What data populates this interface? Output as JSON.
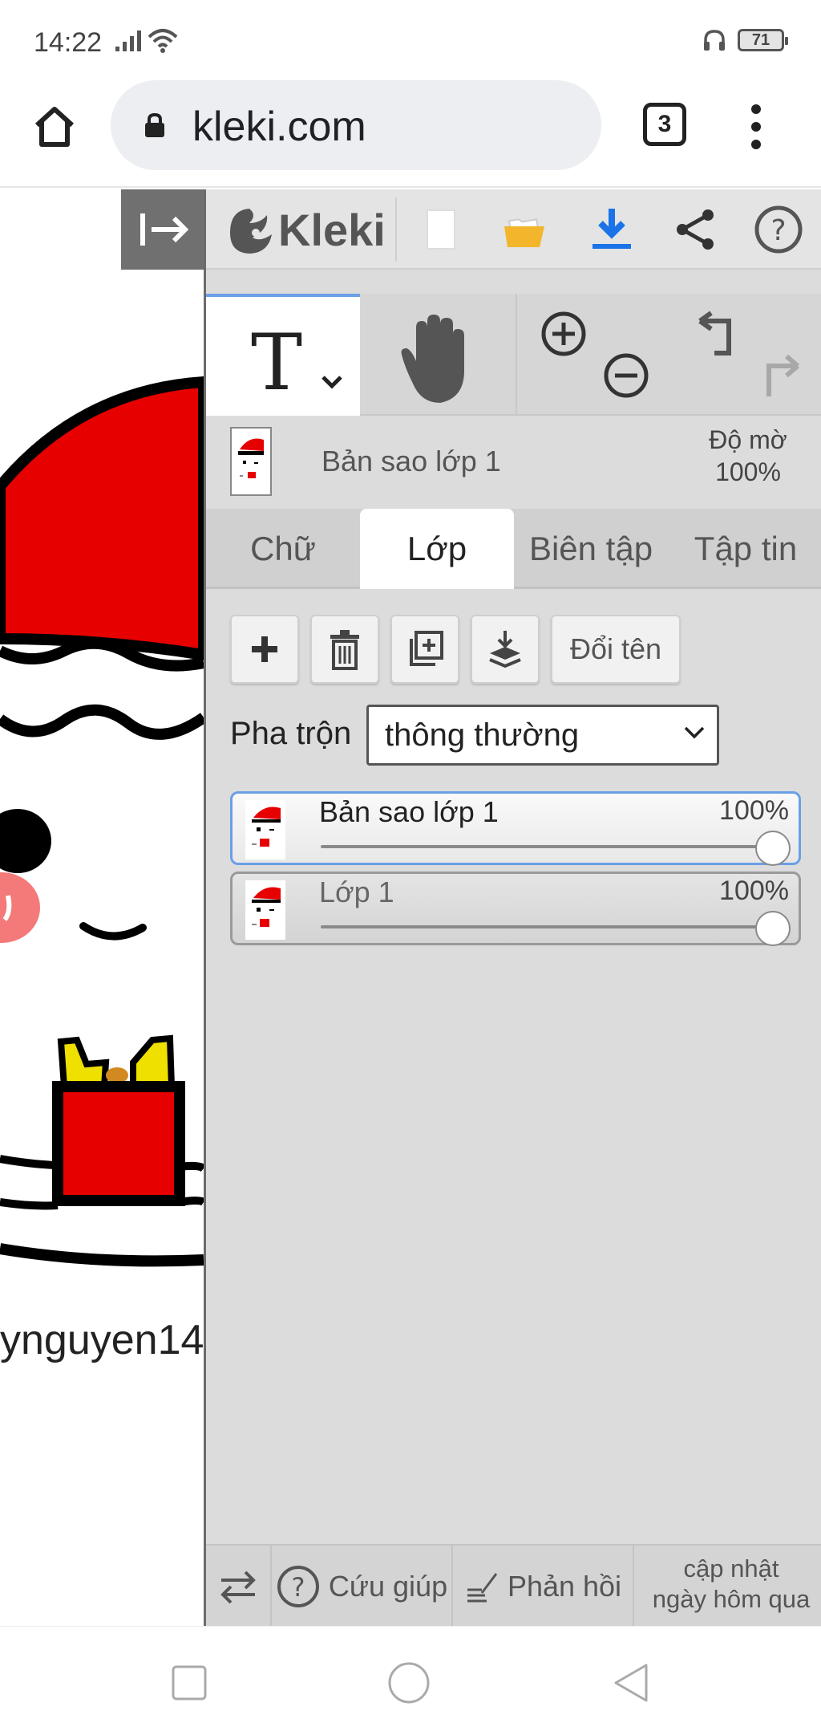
{
  "status": {
    "time": "14:22",
    "battery": "71"
  },
  "browser": {
    "url": "kleki.com",
    "tab_count": "3"
  },
  "app": {
    "logo_text": "Kleki"
  },
  "canvas": {
    "watermark_text": "ynguyen14"
  },
  "layer_info": {
    "name": "Bản sao lớp 1",
    "opacity_label": "Độ mờ",
    "opacity_value": "100%"
  },
  "tabs": [
    {
      "label": "Chữ"
    },
    {
      "label": "Lớp"
    },
    {
      "label": "Biên tập"
    },
    {
      "label": "Tập tin"
    }
  ],
  "layer_panel": {
    "rename_label": "Đổi tên",
    "blend_label": "Pha trộn",
    "blend_value": "thông thường",
    "layers": [
      {
        "name": "Bản sao lớp 1",
        "opacity": "100%",
        "opacity_fraction": 1.0,
        "selected": true
      },
      {
        "name": "Lớp 1",
        "opacity": "100%",
        "opacity_fraction": 1.0,
        "selected": false
      }
    ]
  },
  "footer": {
    "help_label": "Cứu giúp",
    "feedback_label": "Phản hồi",
    "update_line1": "cập nhật",
    "update_line2": "ngày hôm qua"
  },
  "colors": {
    "accent_blue": "#6b9fe6",
    "download_blue": "#1a73e8",
    "folder_yellow": "#f3b52b",
    "santa_red": "#e60000"
  }
}
